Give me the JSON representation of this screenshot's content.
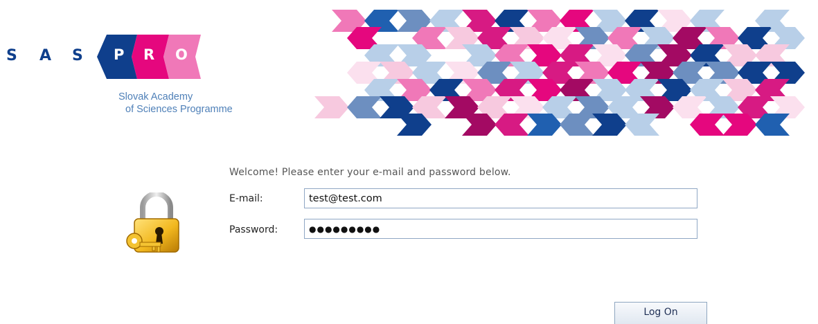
{
  "logo": {
    "sas_letters": [
      "S",
      "A",
      "S"
    ],
    "pro_letters": [
      "P",
      "R",
      "O"
    ],
    "tagline_line1": "Slovak Academy",
    "tagline_line2": "of Sciences Programme",
    "colors": {
      "navy": "#0f3f8c",
      "magenta": "#e5077e",
      "pink": "#f078b8",
      "light_blue": "#b8cfe8"
    }
  },
  "login": {
    "prompt": "Welcome! Please enter your e-mail and password below.",
    "email_label": "E-mail:",
    "email_value": "test@test.com",
    "password_label": "Password:",
    "password_value": "●●●●●●●●●",
    "submit_label": "Log On"
  },
  "icons": {
    "lock": "lock-with-key-icon"
  }
}
